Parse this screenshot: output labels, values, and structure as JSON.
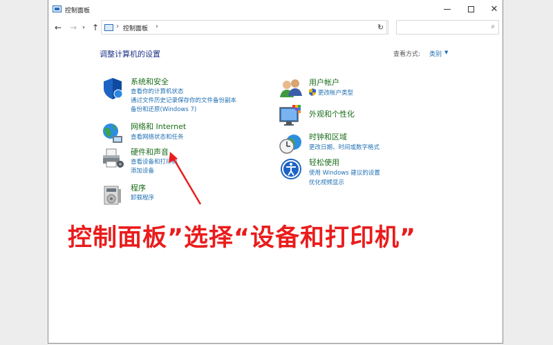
{
  "window": {
    "title": "控制面板",
    "buttons": {
      "minimize": "—",
      "maximize": "",
      "close": "✕"
    }
  },
  "nav": {
    "back": "←",
    "forward": "→",
    "recent": "▾",
    "up": "↑",
    "address_sep_1": "›",
    "address_path": "控制面板",
    "address_sep_2": "›",
    "address_dropdown": "⌄",
    "refresh": "↻",
    "search_placeholder": "",
    "search_glyph": "⌕"
  },
  "main": {
    "page_title": "调整计算机的设置",
    "view_by_label": "查看方式:",
    "view_by_value": "类别",
    "view_by_arrow": "▼"
  },
  "categories_left": [
    {
      "title": "系统和安全",
      "icon": "shield-icon",
      "links": [
        "查看你的计算机状态",
        "通过文件历史记录保存你的文件备份副本",
        "备份和还原(Windows 7)"
      ]
    },
    {
      "title": "网络和 Internet",
      "icon": "globe-network-icon",
      "links": [
        "查看网络状态和任务"
      ]
    },
    {
      "title": "硬件和声音",
      "icon": "printer-icon",
      "links": [
        "查看设备和打印机",
        "添加设备"
      ]
    },
    {
      "title": "程序",
      "icon": "programs-icon",
      "links": [
        "卸载程序"
      ]
    }
  ],
  "categories_right": [
    {
      "title": "用户帐户",
      "icon": "users-icon",
      "links": [
        "更改帐户类型"
      ]
    },
    {
      "title": "外观和个性化",
      "icon": "monitor-palette-icon",
      "links": []
    },
    {
      "title": "时钟和区域",
      "icon": "clock-globe-icon",
      "links": [
        "更改日期、时间或数字格式"
      ]
    },
    {
      "title": "轻松使用",
      "icon": "ease-of-access-icon",
      "links": [
        "使用 Windows 建议的设置",
        "优化视频显示"
      ]
    }
  ],
  "annotation": {
    "text": "控制面板”选择“设备和打印机”",
    "color": "#ea1c1c"
  },
  "colors": {
    "category_title": "#196c19",
    "link": "#1f6fb2",
    "page_title": "#1e3287"
  }
}
